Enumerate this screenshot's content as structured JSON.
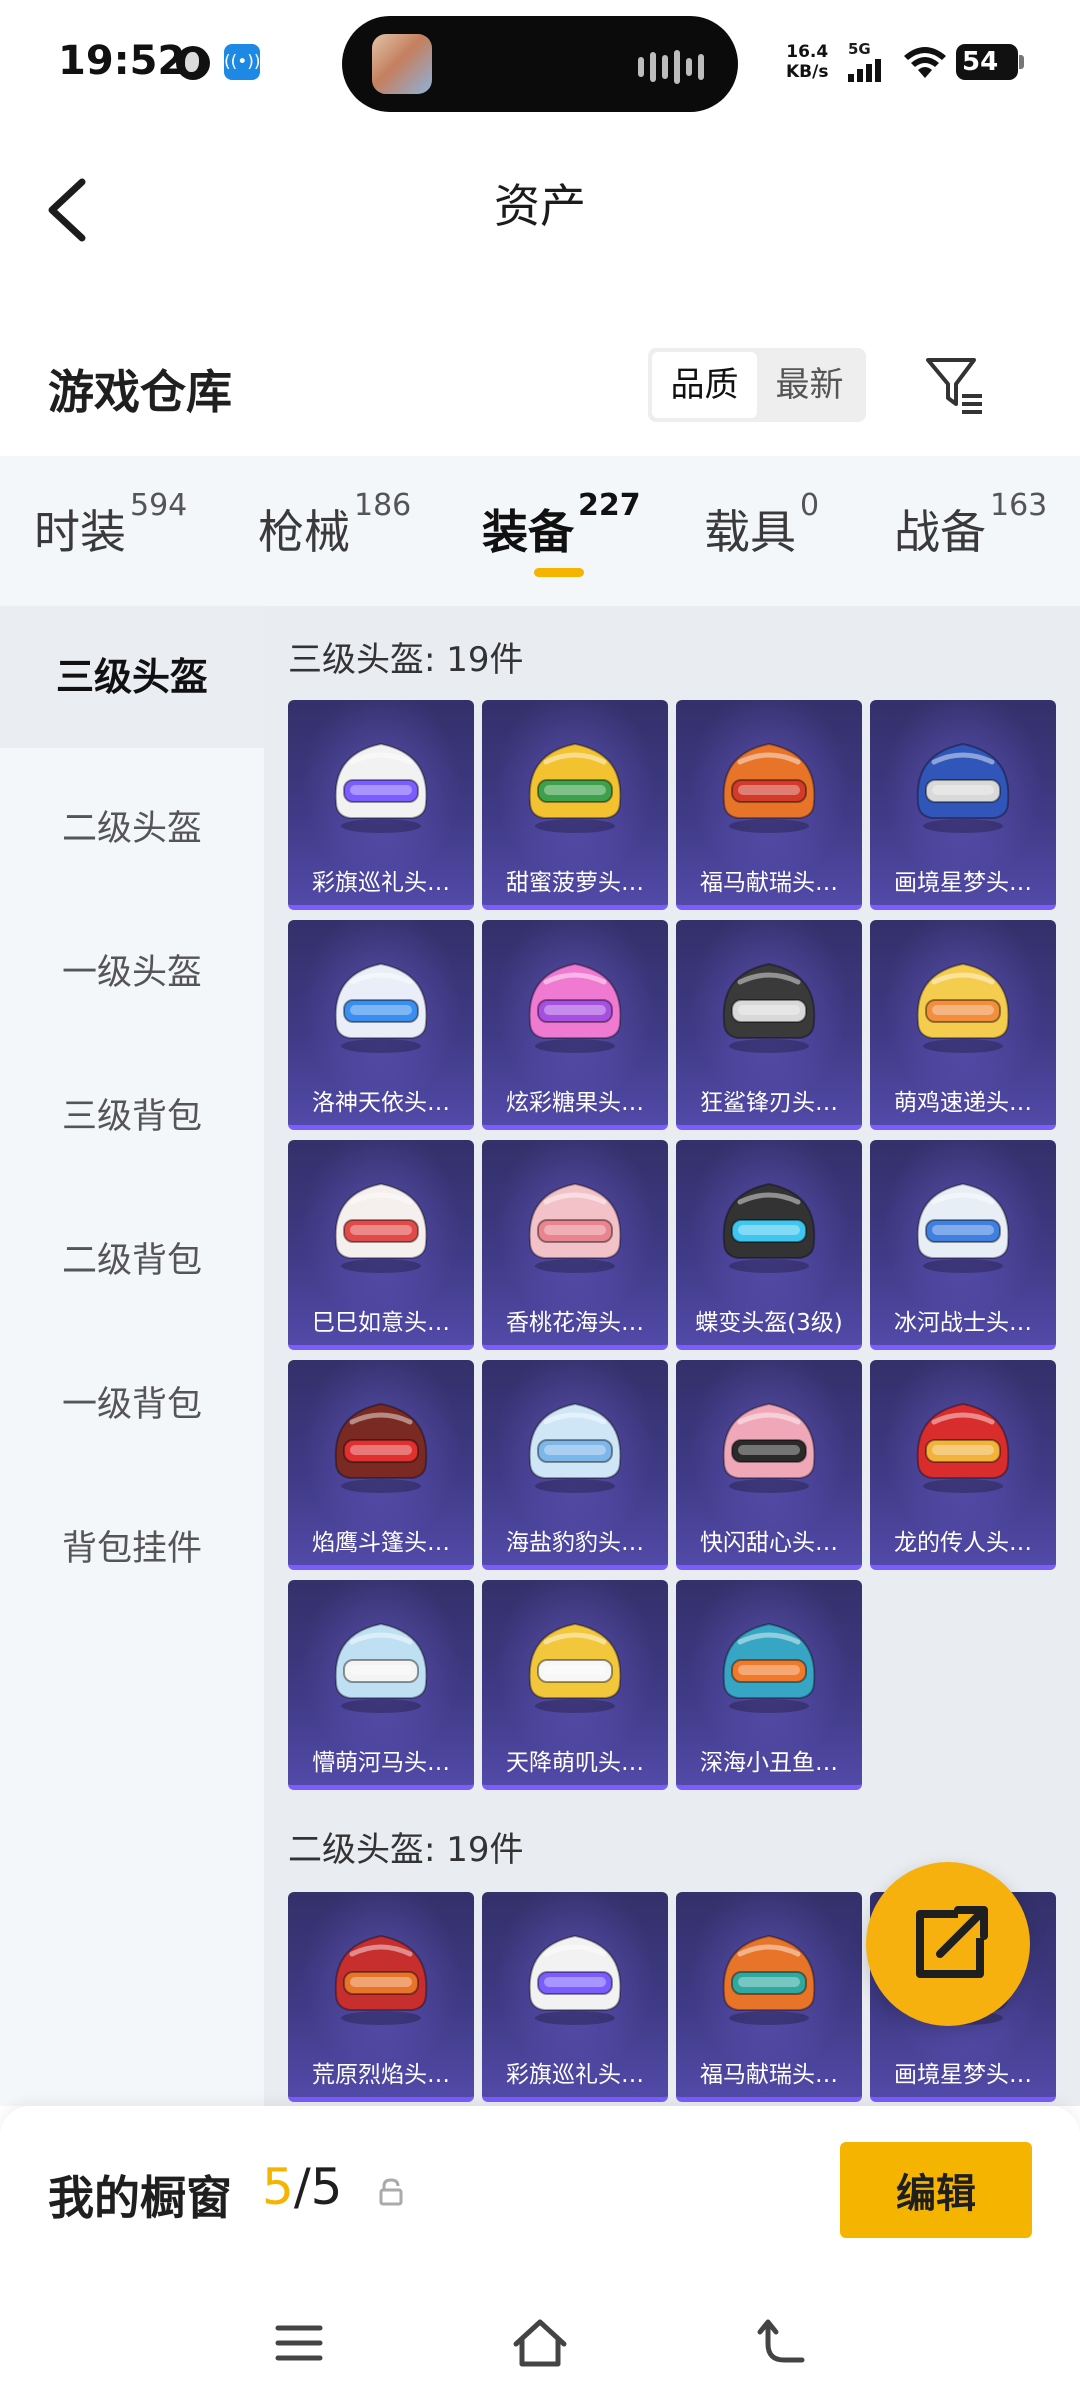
{
  "status_bar": {
    "time": "19:52",
    "speed_value": "16.4",
    "speed_unit": "KB/s",
    "network": "5G",
    "battery": "54",
    "icons": [
      "vpn-globe-icon",
      "radar-icon",
      "wifi-icon",
      "signal-icon",
      "battery-icon"
    ]
  },
  "header": {
    "title": "资产",
    "back_icon": "chevron-left-icon"
  },
  "warehouse": {
    "title": "游戏仓库",
    "sort_options": [
      "品质",
      "最新"
    ],
    "selected_sort": "品质",
    "filter_icon": "filter-icon"
  },
  "category_tabs": [
    {
      "label": "时装",
      "count": "594"
    },
    {
      "label": "枪械",
      "count": "186"
    },
    {
      "label": "装备",
      "count": "227"
    },
    {
      "label": "载具",
      "count": "0"
    },
    {
      "label": "战备",
      "count": "163"
    }
  ],
  "active_tab": "装备",
  "sidebar": {
    "items": [
      "三级头盔",
      "二级头盔",
      "一级头盔",
      "三级背包",
      "二级背包",
      "一级背包",
      "背包挂件"
    ],
    "active": "三级头盔"
  },
  "sections": [
    {
      "title": "三级头盔: 19件",
      "items": [
        {
          "name": "彩旗巡礼头…",
          "color": "#f2f2f2",
          "accent": "#7b5cff"
        },
        {
          "name": "甜蜜菠萝头…",
          "color": "#f2c230",
          "accent": "#3da04a"
        },
        {
          "name": "福马献瑞头…",
          "color": "#e8742a",
          "accent": "#d23a2a"
        },
        {
          "name": "画境星梦头…",
          "color": "#2f56b8",
          "accent": "#d9d9d9"
        },
        {
          "name": "洛神天依头…",
          "color": "#e9eef8",
          "accent": "#3a8ef0"
        },
        {
          "name": "炫彩糖果头…",
          "color": "#f07ad2",
          "accent": "#a64fe0"
        },
        {
          "name": "狂鲨锋刃头…",
          "color": "#3a3a3a",
          "accent": "#d9d9d9"
        },
        {
          "name": "萌鸡速递头…",
          "color": "#f4cc4e",
          "accent": "#f28e3c"
        },
        {
          "name": "巳巳如意头…",
          "color": "#f5f0ee",
          "accent": "#e24a4a"
        },
        {
          "name": "香桃花海头…",
          "color": "#f3c2c8",
          "accent": "#e8858f"
        },
        {
          "name": "蝶变头盔(3级)",
          "color": "#333333",
          "accent": "#3fc6f0"
        },
        {
          "name": "冰河战士头…",
          "color": "#e8eef6",
          "accent": "#3f7fe0"
        },
        {
          "name": "焰鹰斗篷头…",
          "color": "#7a2a22",
          "accent": "#e03030"
        },
        {
          "name": "海盐豹豹头…",
          "color": "#cfe6f7",
          "accent": "#7db6e8"
        },
        {
          "name": "快闪甜心头…",
          "color": "#f0a8b8",
          "accent": "#2a2a2a"
        },
        {
          "name": "龙的传人头…",
          "color": "#d92c2c",
          "accent": "#f2b33a"
        },
        {
          "name": "懵萌河马头…",
          "color": "#bfe0f2",
          "accent": "#f4f4f4"
        },
        {
          "name": "天降萌叽头…",
          "color": "#f2c73c",
          "accent": "#f7f7f7"
        },
        {
          "name": "深海小丑鱼…",
          "color": "#36a6c4",
          "accent": "#f07a2a"
        }
      ]
    },
    {
      "title": "二级头盔: 19件",
      "items": [
        {
          "name": "荒原烈焰头…",
          "color": "#c72e2e",
          "accent": "#e8742a"
        },
        {
          "name": "彩旗巡礼头…",
          "color": "#f2f2f2",
          "accent": "#7b5cff"
        },
        {
          "name": "福马献瑞头…",
          "color": "#e8742a",
          "accent": "#2fa8a0"
        },
        {
          "name": "画境星梦头…",
          "color": "#2f56b8",
          "accent": "#d9d9d9"
        }
      ]
    }
  ],
  "fab_icon": "share-external-icon",
  "showcase": {
    "label": "我的橱窗",
    "current": "5",
    "separator": "/",
    "total": "5",
    "lock_icon": "lock-icon",
    "edit_label": "编辑"
  },
  "system_nav": [
    "menu-icon",
    "home-icon",
    "back-icon"
  ]
}
